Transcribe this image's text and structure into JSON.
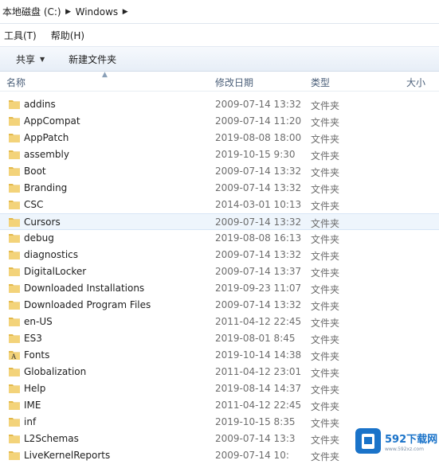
{
  "breadcrumb": {
    "items": [
      {
        "label": "本地磁盘 (C:)"
      },
      {
        "label": "Windows"
      }
    ]
  },
  "menu": {
    "items": [
      {
        "label": "工具(T)"
      },
      {
        "label": "帮助(H)"
      }
    ]
  },
  "toolbar": {
    "share_label": "共享",
    "new_folder_label": "新建文件夹"
  },
  "columns": {
    "name": "名称",
    "date": "修改日期",
    "type": "类型",
    "size": "大小"
  },
  "files": [
    {
      "name": "addins",
      "date": "2009-07-14 13:32",
      "type": "文件夹"
    },
    {
      "name": "AppCompat",
      "date": "2009-07-14 11:20",
      "type": "文件夹"
    },
    {
      "name": "AppPatch",
      "date": "2019-08-08 18:00",
      "type": "文件夹"
    },
    {
      "name": "assembly",
      "date": "2019-10-15 9:30",
      "type": "文件夹"
    },
    {
      "name": "Boot",
      "date": "2009-07-14 13:32",
      "type": "文件夹"
    },
    {
      "name": "Branding",
      "date": "2009-07-14 13:32",
      "type": "文件夹"
    },
    {
      "name": "CSC",
      "date": "2014-03-01 10:13",
      "type": "文件夹"
    },
    {
      "name": "Cursors",
      "date": "2009-07-14 13:32",
      "type": "文件夹"
    },
    {
      "name": "debug",
      "date": "2019-08-08 16:13",
      "type": "文件夹"
    },
    {
      "name": "diagnostics",
      "date": "2009-07-14 13:32",
      "type": "文件夹"
    },
    {
      "name": "DigitalLocker",
      "date": "2009-07-14 13:37",
      "type": "文件夹"
    },
    {
      "name": "Downloaded Installations",
      "date": "2019-09-23 11:07",
      "type": "文件夹"
    },
    {
      "name": "Downloaded Program Files",
      "date": "2009-07-14 13:32",
      "type": "文件夹"
    },
    {
      "name": "en-US",
      "date": "2011-04-12 22:45",
      "type": "文件夹"
    },
    {
      "name": "ES3",
      "date": "2019-08-01 8:45",
      "type": "文件夹"
    },
    {
      "name": "Fonts",
      "date": "2019-10-14 14:38",
      "type": "文件夹"
    },
    {
      "name": "Globalization",
      "date": "2011-04-12 23:01",
      "type": "文件夹"
    },
    {
      "name": "Help",
      "date": "2019-08-14 14:37",
      "type": "文件夹"
    },
    {
      "name": "IME",
      "date": "2011-04-12 22:45",
      "type": "文件夹"
    },
    {
      "name": "inf",
      "date": "2019-10-15 8:35",
      "type": "文件夹"
    },
    {
      "name": "L2Schemas",
      "date": "2009-07-14 13:3",
      "type": "文件夹"
    },
    {
      "name": "LiveKernelReports",
      "date": "2009-07-14 10:",
      "type": "文件夹"
    }
  ],
  "hover_row_index": 7,
  "colors": {
    "folder_fill": "#f3d37a",
    "folder_tab": "#e3b94b",
    "hover": "#eef5fc",
    "brand_blue": "#1a73c9"
  },
  "watermark": {
    "title": "592下载网",
    "subtitle": "www.592xz.com"
  }
}
